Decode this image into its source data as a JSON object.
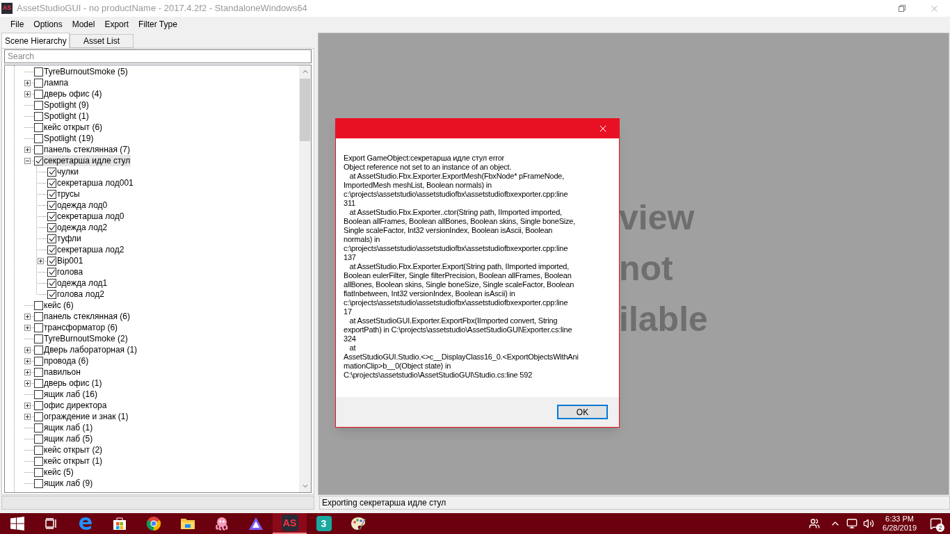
{
  "window": {
    "app_icon_text": "AS",
    "title": "AssetStudioGUI - no productName - 2017.4.2f2 - StandaloneWindows64"
  },
  "menu": [
    "File",
    "Options",
    "Model",
    "Export",
    "Filter Type"
  ],
  "tabs": [
    {
      "label": "Scene Hierarchy",
      "selected": true
    },
    {
      "label": "Asset List",
      "selected": false
    }
  ],
  "search": {
    "placeholder": "Search"
  },
  "tree": [
    {
      "label": "TyreBurnoutSmoke (5)",
      "kind": "leaf",
      "checked": false,
      "selected": false
    },
    {
      "label": "лампа",
      "kind": "collapsed",
      "checked": false,
      "selected": false
    },
    {
      "label": "дверь офис (4)",
      "kind": "collapsed",
      "checked": false,
      "selected": false
    },
    {
      "label": "Spotlight (9)",
      "kind": "leaf",
      "checked": false,
      "selected": false
    },
    {
      "label": "Spotlight (1)",
      "kind": "leaf",
      "checked": false,
      "selected": false
    },
    {
      "label": "кейс открыт (6)",
      "kind": "leaf",
      "checked": false,
      "selected": false
    },
    {
      "label": "Spotlight (19)",
      "kind": "leaf",
      "checked": false,
      "selected": false
    },
    {
      "label": "панель стеклянная (7)",
      "kind": "collapsed",
      "checked": false,
      "selected": false
    },
    {
      "label": "секретарша идле стул",
      "kind": "expanded",
      "checked": true,
      "selected": true,
      "children": [
        {
          "label": "чулки",
          "kind": "leaf",
          "checked": true,
          "selected": false
        },
        {
          "label": "секретарша лод001",
          "kind": "leaf",
          "checked": true,
          "selected": false
        },
        {
          "label": "трусы",
          "kind": "leaf",
          "checked": true,
          "selected": false
        },
        {
          "label": "одежда лод0",
          "kind": "leaf",
          "checked": true,
          "selected": false
        },
        {
          "label": "секретарша лод0",
          "kind": "leaf",
          "checked": true,
          "selected": false
        },
        {
          "label": "одежда лод2",
          "kind": "leaf",
          "checked": true,
          "selected": false
        },
        {
          "label": "туфли",
          "kind": "leaf",
          "checked": true,
          "selected": false
        },
        {
          "label": "секретарша лод2",
          "kind": "leaf",
          "checked": true,
          "selected": false
        },
        {
          "label": "Bip001",
          "kind": "collapsed",
          "checked": true,
          "selected": false
        },
        {
          "label": "голова",
          "kind": "leaf",
          "checked": true,
          "selected": false
        },
        {
          "label": "одежда лод1",
          "kind": "leaf",
          "checked": true,
          "selected": false
        },
        {
          "label": "голова лод2",
          "kind": "leaf",
          "checked": true,
          "selected": false
        }
      ]
    },
    {
      "label": "кейс (6)",
      "kind": "leaf",
      "checked": false,
      "selected": false
    },
    {
      "label": "панель стеклянная (6)",
      "kind": "collapsed",
      "checked": false,
      "selected": false
    },
    {
      "label": "трансформатор (6)",
      "kind": "collapsed",
      "checked": false,
      "selected": false
    },
    {
      "label": "TyreBurnoutSmoke (2)",
      "kind": "leaf",
      "checked": false,
      "selected": false
    },
    {
      "label": "Дверь лабораторная (1)",
      "kind": "collapsed",
      "checked": false,
      "selected": false
    },
    {
      "label": "провода (6)",
      "kind": "collapsed",
      "checked": false,
      "selected": false
    },
    {
      "label": "павильон",
      "kind": "collapsed",
      "checked": false,
      "selected": false
    },
    {
      "label": "дверь офис (1)",
      "kind": "collapsed",
      "checked": false,
      "selected": false
    },
    {
      "label": "ящик лаб (16)",
      "kind": "leaf",
      "checked": false,
      "selected": false
    },
    {
      "label": "офис директора",
      "kind": "collapsed",
      "checked": false,
      "selected": false
    },
    {
      "label": "ограждение и знак (1)",
      "kind": "collapsed",
      "checked": false,
      "selected": false
    },
    {
      "label": "ящик лаб (1)",
      "kind": "leaf",
      "checked": false,
      "selected": false
    },
    {
      "label": "ящик лаб (5)",
      "kind": "leaf",
      "checked": false,
      "selected": false
    },
    {
      "label": "кейс открыт (2)",
      "kind": "leaf",
      "checked": false,
      "selected": false
    },
    {
      "label": "кейс открыт (1)",
      "kind": "leaf",
      "checked": false,
      "selected": false
    },
    {
      "label": "кейс (5)",
      "kind": "leaf",
      "checked": false,
      "selected": false
    },
    {
      "label": "ящик лаб (9)",
      "kind": "leaf",
      "checked": false,
      "selected": false
    }
  ],
  "preview": {
    "lines": [
      "view",
      "not",
      "ilable"
    ]
  },
  "status_bar": "Exporting секретарша идле стул",
  "dialog": {
    "lines": [
      "Export GameObject:секретарша идле стул error",
      "Object reference not set to an instance of an object.",
      "   at AssetStudio.Fbx.Exporter.ExportMesh(FbxNode* pFrameNode,",
      "ImportedMesh meshList, Boolean normals) in",
      "c:\\projects\\assetstudio\\assetstudiofbx\\assetstudiofbxexporter.cpp:line",
      "311",
      "   at AssetStudio.Fbx.Exporter..ctor(String path, IImported imported,",
      "Boolean allFrames, Boolean allBones, Boolean skins, Single boneSize,",
      "Single scaleFactor, Int32 versionIndex, Boolean isAscii, Boolean",
      "normals) in",
      "c:\\projects\\assetstudio\\assetstudiofbx\\assetstudiofbxexporter.cpp:line",
      "137",
      "   at AssetStudio.Fbx.Exporter.Export(String path, IImported imported,",
      "Boolean eulerFilter, Single filterPrecision, Boolean allFrames, Boolean",
      "allBones, Boolean skins, Single boneSize, Single scaleFactor, Boolean",
      "flatInbetween, Int32 versionIndex, Boolean isAscii) in",
      "c:\\projects\\assetstudio\\assetstudiofbx\\assetstudiofbxexporter.cpp:line",
      "17",
      "   at AssetStudioGUI.Exporter.ExportFbx(IImported convert, String",
      "exportPath) in C:\\projects\\assetstudio\\AssetStudioGUI\\Exporter.cs:line",
      "324",
      "   at",
      "AssetStudioGUI.Studio.<>c__DisplayClass16_0.<ExportObjectsWithAni",
      "mationClip>b__0(Object state) in",
      "C:\\projects\\assetstudio\\AssetStudioGUI\\Studio.cs:line 592"
    ],
    "ok": "OK"
  },
  "taskbar": {
    "apps": [
      {
        "kind": "start"
      },
      {
        "kind": "taskview"
      },
      {
        "kind": "edge"
      },
      {
        "kind": "store"
      },
      {
        "kind": "chrome"
      },
      {
        "kind": "explorer"
      },
      {
        "kind": "octopus"
      },
      {
        "kind": "triangle"
      },
      {
        "kind": "as",
        "text": "AS",
        "selected": true
      },
      {
        "kind": "three",
        "text": "3"
      },
      {
        "kind": "palette"
      }
    ],
    "time": "6:33 PM",
    "date": "6/28/2019",
    "notifications": "2"
  }
}
